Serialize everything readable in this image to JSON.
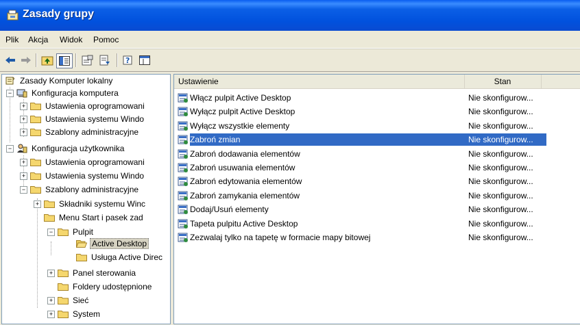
{
  "window": {
    "title": "Zasady grupy"
  },
  "menu": [
    "Plik",
    "Akcja",
    "Widok",
    "Pomoc"
  ],
  "toolbar_icons": [
    "back-arrow-icon",
    "forward-arrow-icon",
    "up-folder-icon",
    "show-tree-icon",
    "properties-icon",
    "export-list-icon",
    "help-icon",
    "show-console-icon"
  ],
  "tree": [
    {
      "label": "Zasady Komputer lokalny"
    },
    {
      "label": "Konfiguracja komputera"
    },
    {
      "label": "Ustawienia oprogramowani"
    },
    {
      "label": "Ustawienia systemu Windo"
    },
    {
      "label": "Szablony administracyjne"
    },
    {
      "label": "Konfiguracja użytkownika"
    },
    {
      "label": "Ustawienia oprogramowani"
    },
    {
      "label": "Ustawienia systemu Windo"
    },
    {
      "label": "Szablony administracyjne"
    },
    {
      "label": "Składniki systemu Winc"
    },
    {
      "label": "Menu Start i pasek zad"
    },
    {
      "label": "Pulpit"
    },
    {
      "label": "Active Desktop"
    },
    {
      "label": "Usługa Active Direc"
    },
    {
      "label": "Panel sterowania"
    },
    {
      "label": "Foldery udostępnione"
    },
    {
      "label": "Sieć"
    },
    {
      "label": "System"
    }
  ],
  "list": {
    "columns": [
      "Ustawienie",
      "Stan"
    ],
    "rows": [
      {
        "name": "Włącz pulpit Active Desktop",
        "state": "Nie skonfigurow..."
      },
      {
        "name": "Wyłącz pulpit Active Desktop",
        "state": "Nie skonfigurow..."
      },
      {
        "name": "Wyłącz wszystkie elementy",
        "state": "Nie skonfigurow..."
      },
      {
        "name": "Zabroń zmian",
        "state": "Nie skonfigurow..."
      },
      {
        "name": "Zabroń dodawania elementów",
        "state": "Nie skonfigurow..."
      },
      {
        "name": "Zabroń usuwania elementów",
        "state": "Nie skonfigurow..."
      },
      {
        "name": "Zabroń edytowania elementów",
        "state": "Nie skonfigurow..."
      },
      {
        "name": "Zabroń zamykania elementów",
        "state": "Nie skonfigurow..."
      },
      {
        "name": "Dodaj/Usuń elementy",
        "state": "Nie skonfigurow..."
      },
      {
        "name": "Tapeta pulpitu Active Desktop",
        "state": "Nie skonfigurow..."
      },
      {
        "name": "Zezwalaj tylko na tapetę w formacie mapy bitowej",
        "state": "Nie skonfigurow..."
      }
    ],
    "selected_row": "Zabroń zmian"
  },
  "colors": {
    "titlebar": "#0151dd",
    "selection": "#316ac5",
    "folder": "#f5d76e"
  }
}
